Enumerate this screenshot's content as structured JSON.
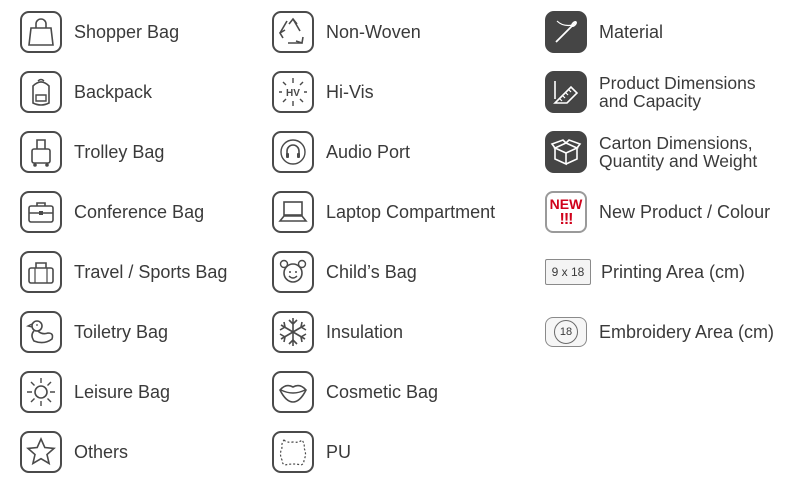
{
  "col1": {
    "shopper": "Shopper Bag",
    "backpack": "Backpack",
    "trolley": "Trolley Bag",
    "conference": "Conference Bag",
    "travel": "Travel / Sports Bag",
    "toiletry": "Toiletry Bag",
    "leisure": "Leisure Bag",
    "others": "Others"
  },
  "col2": {
    "nonwoven": "Non-Woven",
    "hivis": "Hi-Vis",
    "hivis_icon_text": "HV",
    "audio": "Audio Port",
    "laptop": "Laptop Compartment",
    "child": "Child’s Bag",
    "insulation": "Insulation",
    "cosmetic": "Cosmetic Bag",
    "pu": "PU"
  },
  "col3": {
    "material": "Material",
    "product_dim_1": "Product Dimensions",
    "product_dim_2": "and Capacity",
    "carton_1": "Carton Dimensions,",
    "carton_2": "Quantity and Weight",
    "new_badge_1": "NEW",
    "new_badge_2": "!!!",
    "new_product": "New Product / Colour",
    "print_box": "9 x 18",
    "printing": "Printing Area (cm)",
    "embroidery_value": "18",
    "embroidery": "Embroidery Area (cm)"
  },
  "colors": {
    "text": "#3a3a3a",
    "icon_border": "#4a4a4a",
    "dark_icon": "#454545",
    "new_red": "#d0021b"
  }
}
